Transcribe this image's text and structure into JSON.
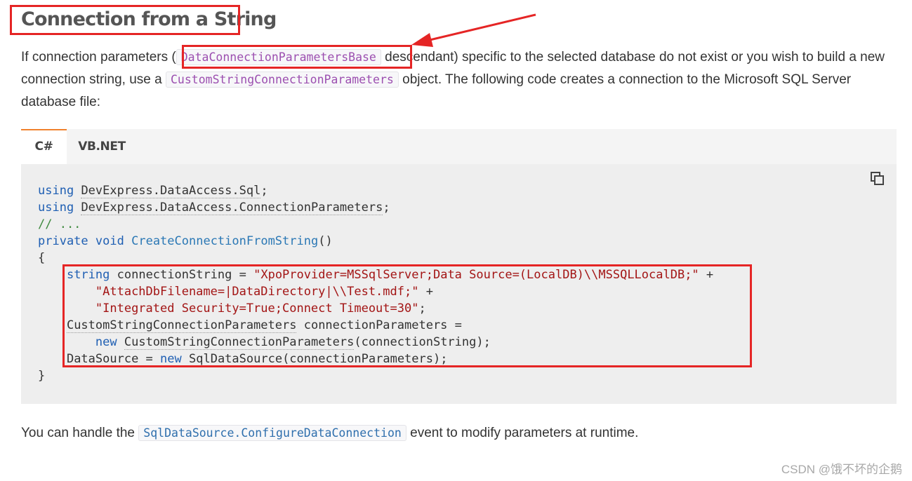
{
  "heading": "Connection from a String",
  "intro": {
    "part1": "If connection parameters (",
    "code1": "DataConnectionParametersBase",
    "part2": " descendant) specific to the selected database do not exist or you wish to build a new connection string, use a ",
    "code2": "CustomStringConnectionParameters",
    "part3": " object. The following code creates a connection to the Microsoft SQL Server database file:"
  },
  "tabs": [
    {
      "label": "C#",
      "active": true
    },
    {
      "label": "VB.NET",
      "active": false
    }
  ],
  "code": {
    "copy_icon": "copy-icon",
    "kw_using": "using",
    "ns1": "DevExpress.DataAccess.Sql",
    "ns2": "DevExpress.DataAccess.ConnectionParameters",
    "comment": "// ...",
    "kw_private": "private",
    "kw_void": "void",
    "method": "CreateConnectionFromString",
    "kw_string": "string",
    "var_cs": "connectionString",
    "str1": "\"XpoProvider=MSSqlServer;Data Source=(LocalDB)\\\\MSSQLLocalDB;\"",
    "str2": "\"AttachDbFilename=|DataDirectory|\\\\Test.mdf;\"",
    "str3": "\"Integrated Security=True;Connect Timeout=30\"",
    "type_cscp": "CustomStringConnectionParameters",
    "var_cp": "connectionParameters",
    "kw_new": "new",
    "ctor_args": "(connectionString);",
    "prop_ds": "DataSource",
    "type_sds": "SqlDataSource",
    "ctor_args2": "(connectionParameters);"
  },
  "footer_text": {
    "part1": "You can handle the ",
    "code": "SqlDataSource.ConfigureDataConnection",
    "part2": " event to modify parameters at runtime."
  },
  "watermark": "CSDN @饿不坏的企鹅",
  "annotation_color": "#e52525",
  "accent_color": "#f0812d"
}
